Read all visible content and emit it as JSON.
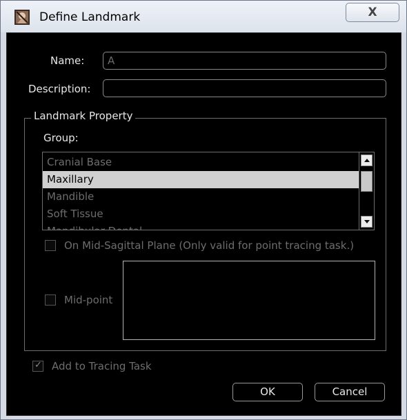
{
  "window": {
    "title": "Define Landmark",
    "close_label": "X"
  },
  "form": {
    "name_label": "Name:",
    "name_value": "A",
    "description_label": "Description:",
    "description_value": ""
  },
  "landmark_property": {
    "title": "Landmark Property",
    "group_label": "Group:",
    "groups": [
      {
        "label": "Cranial Base",
        "selected": false
      },
      {
        "label": "Maxillary",
        "selected": true
      },
      {
        "label": "Mandible",
        "selected": false
      },
      {
        "label": "Soft Tissue",
        "selected": false
      },
      {
        "label": "Mandibular Dental",
        "selected": false
      }
    ],
    "mid_sagittal_label": "On Mid-Sagittal Plane (Only valid for point tracing task.)",
    "mid_sagittal_checked": false,
    "midpoint_label": "Mid-point",
    "midpoint_checked": false
  },
  "add_to_tracing": {
    "label": "Add to Tracing Task",
    "checked": true
  },
  "buttons": {
    "ok": "OK",
    "cancel": "Cancel"
  }
}
